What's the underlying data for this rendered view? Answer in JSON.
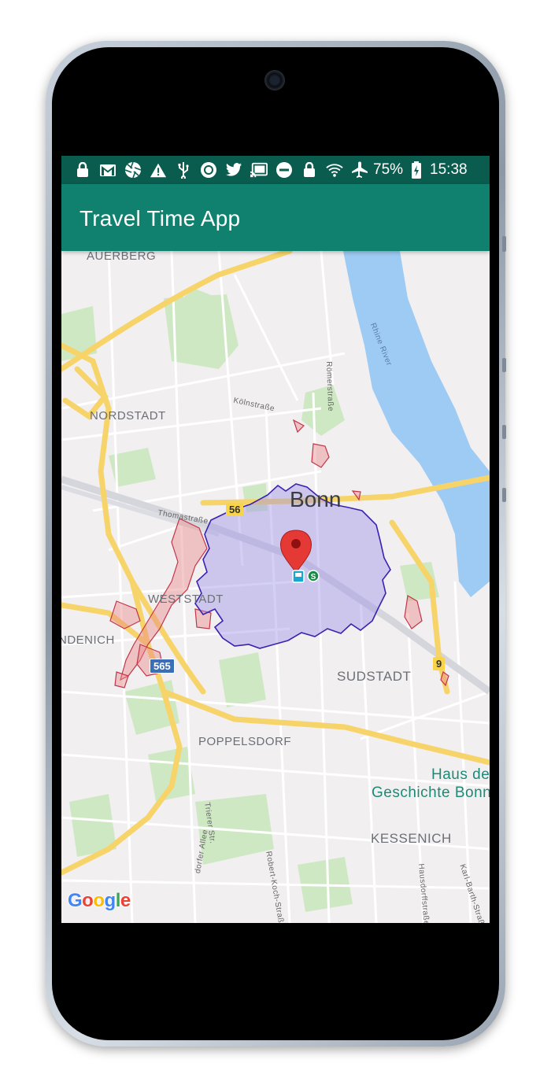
{
  "status_bar": {
    "icons": [
      "lock-icon",
      "gmail-icon",
      "aperture-icon",
      "warning-icon",
      "usb-icon",
      "record-icon",
      "twitter-icon",
      "cast-icon",
      "do-not-disturb-icon",
      "lock-icon",
      "wifi-icon",
      "airplane-icon"
    ],
    "battery_percent": "75%",
    "time": "15:38"
  },
  "app_bar": {
    "title": "Travel Time App"
  },
  "map": {
    "labels": {
      "auerberg": "AUERBERG",
      "nordstadt": "NORDSTADT",
      "bonn": "Bonn",
      "weststadt": "WESTSTADT",
      "endenich": "NDENICH",
      "sudstadt": "SUDSTADT",
      "poppelsdorf": "POPPELSDORF",
      "haus_line1": "Haus de",
      "haus_line2": "Geschichte Bonn",
      "kessenich": "KESSENICH",
      "rhine": "Rhine River",
      "koelnstrasse": "Kölnstraße",
      "roemerstrasse": "Römerstraße",
      "thomastrasse": "Thomastraße",
      "trierer": "Trierer Str.",
      "robert_koch": "Robert-Koch-Straße",
      "hausdorff": "Hausdorffstraße",
      "karl_barth": "Karl-Barth-Straße",
      "allee": "dorfer Allee"
    },
    "shields": {
      "b56": "56",
      "a565": "565",
      "b9": "9"
    },
    "google_logo": "Google",
    "colors": {
      "isochrone_fill": "#9f94e6",
      "isochrone_stroke": "#3a22b0",
      "outer_fill": "#e88a8a",
      "outer_stroke": "#c2364a",
      "marker": "#e53935",
      "water": "#9ecbf3",
      "road_major": "#f7d46a",
      "park": "#cfe8c4"
    }
  }
}
